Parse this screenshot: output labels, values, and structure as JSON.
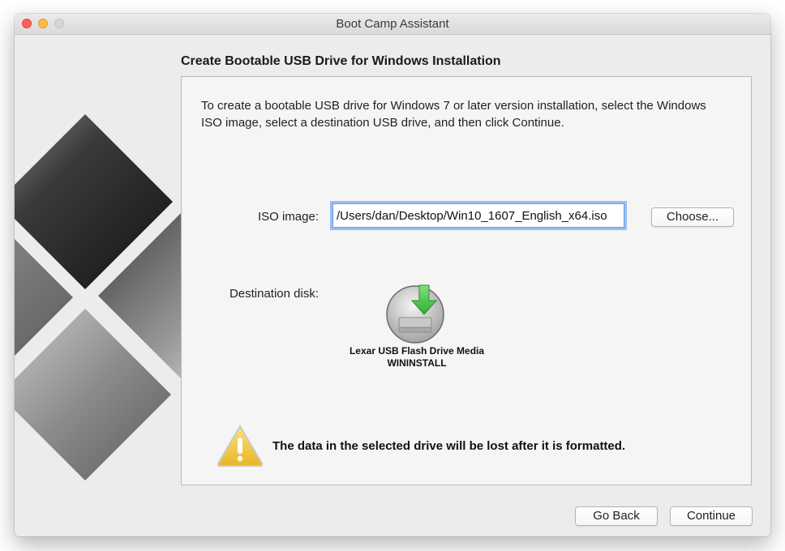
{
  "window": {
    "title": "Boot Camp Assistant"
  },
  "heading": "Create Bootable USB Drive for Windows Installation",
  "intro": "To create a bootable USB drive for Windows 7 or later version installation, select the Windows ISO image, select a destination USB drive, and then click Continue.",
  "iso": {
    "label": "ISO image:",
    "value": "/Users/dan/Desktop/Win10_1607_English_x64.iso",
    "choose_label": "Choose..."
  },
  "destination": {
    "label": "Destination disk:",
    "disk_name": "Lexar USB Flash Drive Media",
    "volume_name": "WININSTALL"
  },
  "warning": "The data in the selected drive will be lost after it is formatted.",
  "footer": {
    "back_label": "Go Back",
    "continue_label": "Continue"
  },
  "colors": {
    "focus_ring": "#4a90e2",
    "warning_yellow": "#f2c63a",
    "arrow_green": "#3cc640"
  }
}
